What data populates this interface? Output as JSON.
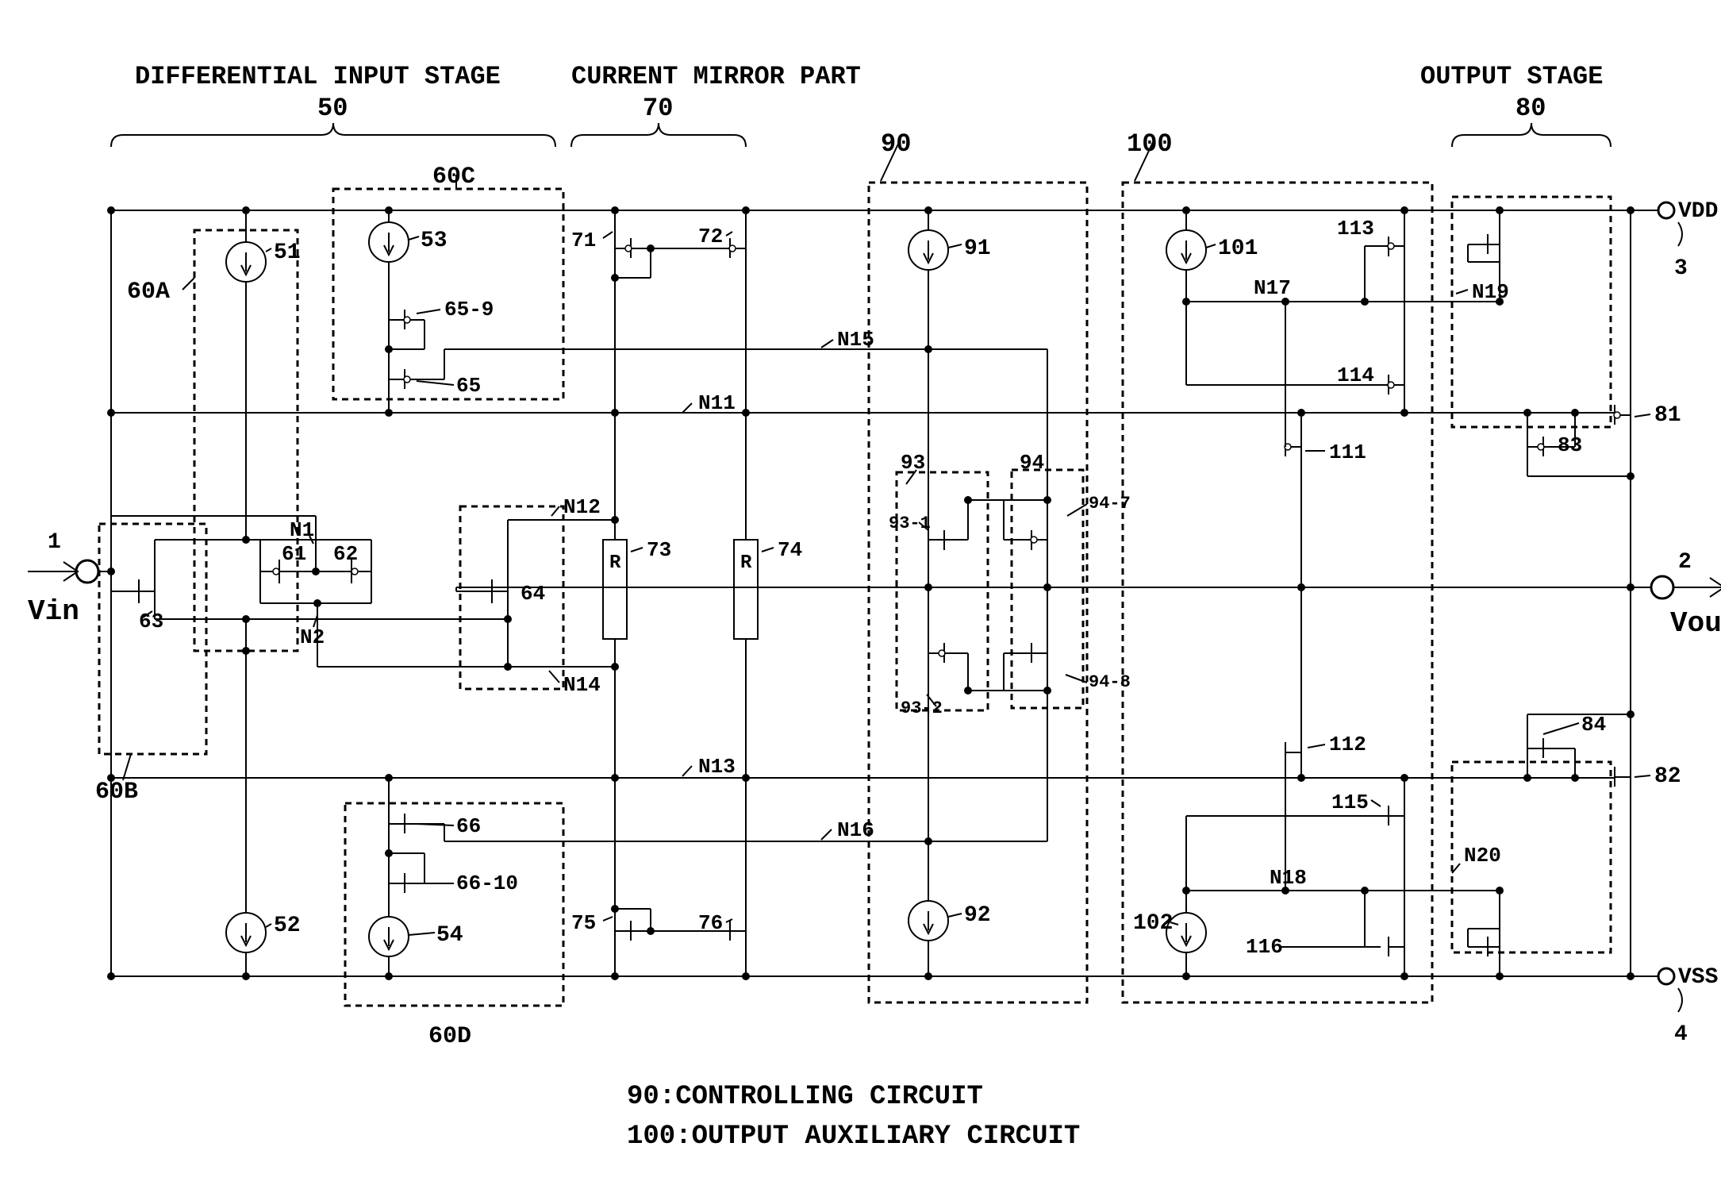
{
  "diagram_type": "circuit_schematic",
  "title_labels": {
    "differential_input_stage": "DIFFERENTIAL INPUT STAGE",
    "differential_input_stage_num": "50",
    "current_mirror_part": "CURRENT MIRROR PART",
    "current_mirror_part_num": "70",
    "output_stage": "OUTPUT STAGE",
    "output_stage_num": "80"
  },
  "terminals": {
    "vin": "Vin",
    "vin_num": "1",
    "vout": "Vout",
    "vout_num": "2",
    "vdd": "VDD",
    "vdd_num": "3",
    "vss": "VSS",
    "vss_num": "4"
  },
  "block_labels": {
    "60A": "60A",
    "60B": "60B",
    "60C": "60C",
    "60D": "60D",
    "90": "90",
    "100": "100"
  },
  "component_labels": {
    "51": "51",
    "52": "52",
    "53": "53",
    "54": "54",
    "61": "61",
    "62": "62",
    "63": "63",
    "64": "64",
    "65": "65",
    "65_9": "65-9",
    "66": "66",
    "66_10": "66-10",
    "71": "71",
    "72": "72",
    "73": "73",
    "74": "74",
    "75": "75",
    "76": "76",
    "81": "81",
    "82": "82",
    "83": "83",
    "84": "84",
    "91": "91",
    "92": "92",
    "93": "93",
    "93_1": "93-1",
    "93_2": "93-2",
    "94": "94",
    "94_7": "94-7",
    "94_8": "94-8",
    "101": "101",
    "102": "102",
    "111": "111",
    "112": "112",
    "113": "113",
    "114": "114",
    "115": "115",
    "116": "116",
    "R": "R"
  },
  "node_labels": {
    "N1": "N1",
    "N2": "N2",
    "N11": "N11",
    "N12": "N12",
    "N13": "N13",
    "N14": "N14",
    "N15": "N15",
    "N16": "N16",
    "N17": "N17",
    "N18": "N18",
    "N19": "N19",
    "N20": "N20"
  },
  "footer": {
    "line1": "90:CONTROLLING CIRCUIT",
    "line2": "100:OUTPUT AUXILIARY CIRCUIT"
  }
}
